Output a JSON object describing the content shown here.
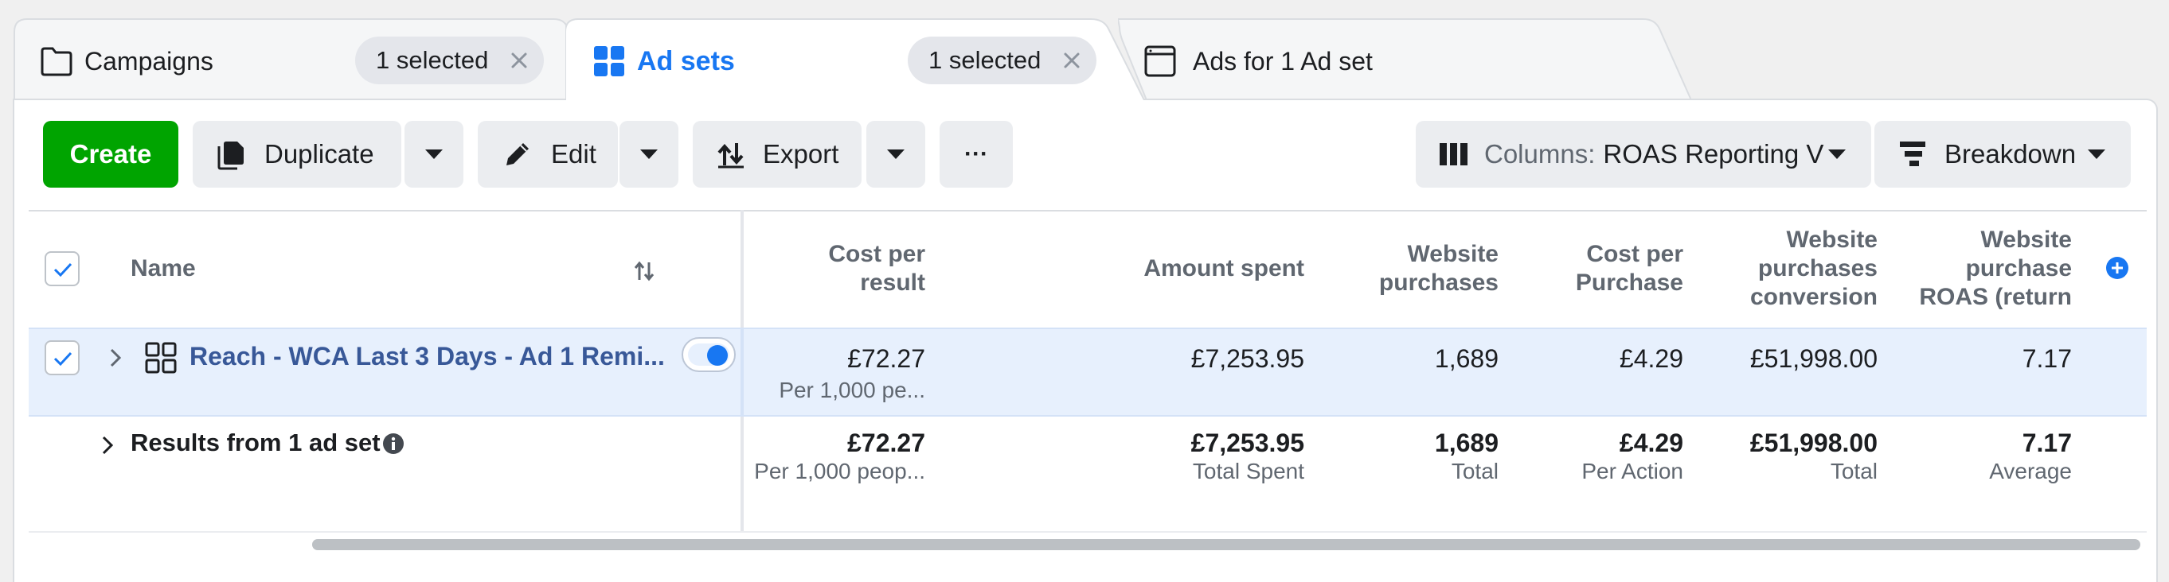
{
  "tabs": [
    {
      "label": "Campaigns",
      "selected_text": "1 selected",
      "active": false
    },
    {
      "label": "Ad sets",
      "selected_text": "1 selected",
      "active": true
    },
    {
      "label": "Ads for 1 Ad set",
      "active": false
    }
  ],
  "toolbar": {
    "create_label": "Create",
    "duplicate_label": "Duplicate",
    "edit_label": "Edit",
    "export_label": "Export",
    "more_label": "···",
    "columns_prefix": "Columns:",
    "columns_value": "ROAS Reporting V",
    "breakdown_label": "Breakdown"
  },
  "table": {
    "headers": {
      "name": "Name",
      "cost_per_result": [
        "Cost per",
        "result"
      ],
      "amount_spent": "Amount spent",
      "website_purchases": [
        "Website",
        "purchases"
      ],
      "cost_per_purchase": [
        "Cost per",
        "Purchase"
      ],
      "website_purchases_conversion": [
        "Website",
        "purchases",
        "conversion"
      ],
      "website_purchase_roas": [
        "Website",
        "purchase",
        "ROAS (return"
      ]
    },
    "row": {
      "name": "Reach - WCA Last 3 Days - Ad 1 Remi...",
      "cost_per_result": "£72.27",
      "cost_per_result_sub": "Per 1,000 pe...",
      "amount_spent": "£7,253.95",
      "website_purchases": "1,689",
      "cost_per_purchase": "£4.29",
      "website_purchases_conversion": "£51,998.00",
      "website_purchase_roas": "7.17",
      "active": true
    },
    "summary": {
      "label": "Results from 1 ad set",
      "cost_per_result": "£72.27",
      "cost_per_result_sub": "Per 1,000 peop...",
      "amount_spent": "£7,253.95",
      "amount_spent_sub": "Total Spent",
      "website_purchases": "1,689",
      "website_purchases_sub": "Total",
      "cost_per_purchase": "£4.29",
      "cost_per_purchase_sub": "Per Action",
      "website_purchases_conversion": "£51,998.00",
      "website_purchases_conversion_sub": "Total",
      "website_purchase_roas": "7.17",
      "website_purchase_roas_sub": "Average"
    }
  },
  "colors": {
    "accent": "#1877f2",
    "create_green": "#00a400",
    "selected_row": "#e7f0fd",
    "link": "#385898"
  },
  "icons": [
    "folder-icon",
    "grid-icon",
    "ad-window-icon",
    "close-icon",
    "duplicate-icon",
    "pencil-icon",
    "export-icon",
    "chevron-down-icon",
    "columns-icon",
    "breakdown-icon",
    "sort-icon",
    "checkmark-icon",
    "chevron-right-icon",
    "info-icon",
    "plus-circle-icon"
  ]
}
